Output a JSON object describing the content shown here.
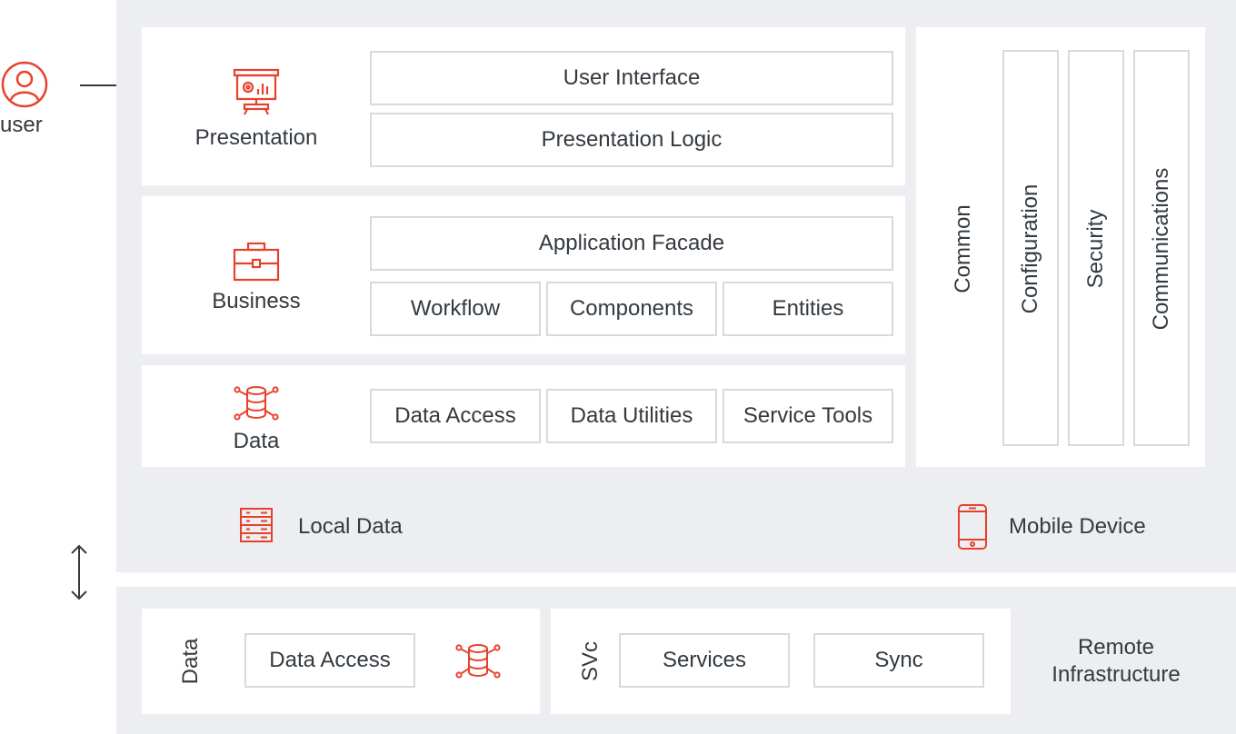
{
  "colors": {
    "accent": "#e8412b",
    "region_bg": "#eceef1",
    "box_border": "#d6d9dd",
    "text": "#333a40"
  },
  "user": {
    "label": "user",
    "icon": "user-circle-icon"
  },
  "local": {
    "presentation": {
      "label": "Presentation",
      "icon": "presentation-board-icon",
      "items": [
        "User Interface",
        "Presentation Logic"
      ]
    },
    "business": {
      "label": "Business",
      "icon": "briefcase-icon",
      "items": [
        "Application Facade",
        "Workflow",
        "Components",
        "Entities"
      ]
    },
    "data": {
      "label": "Data",
      "icon": "database-network-icon",
      "items": [
        "Data Access",
        "Data Utilities",
        "Service Tools"
      ]
    },
    "crosscutting": {
      "title": "Common",
      "items": [
        "Configuration",
        "Security",
        "Communications"
      ]
    },
    "local_data": {
      "label": "Local Data",
      "icon": "server-rack-icon"
    },
    "mobile_device": {
      "label": "Mobile Device",
      "icon": "smartphone-icon"
    }
  },
  "remote": {
    "data": {
      "label": "Data",
      "items": [
        "Data Access"
      ],
      "icon": "database-network-icon"
    },
    "svc": {
      "label": "SVc",
      "items": [
        "Services",
        "Sync"
      ]
    },
    "title": [
      "Remote",
      "Infrastructure"
    ]
  }
}
